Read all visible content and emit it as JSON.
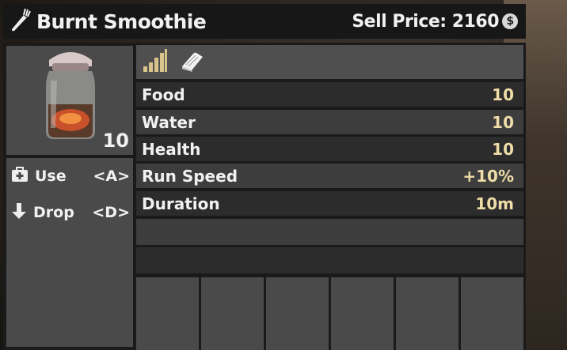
{
  "item": {
    "name": "Burnt Smoothie",
    "sell_label": "Sell Price: 2160",
    "coin_symbol": "$",
    "quantity": "10"
  },
  "actions": [
    {
      "label": "Use",
      "key": "<A>"
    },
    {
      "label": "Drop",
      "key": "<D>"
    }
  ],
  "stats": [
    {
      "name": "Food",
      "value": "10"
    },
    {
      "name": "Water",
      "value": "10"
    },
    {
      "name": "Health",
      "value": "10"
    },
    {
      "name": "Run Speed",
      "value": "+10%"
    },
    {
      "name": "Duration",
      "value": "10m"
    }
  ],
  "colors": {
    "stat_value": "#f0dca8",
    "quality_bars": "#d8c48a"
  },
  "icons": [
    "fork-icon",
    "quality-bars-icon",
    "book-icon",
    "medkit-icon",
    "arrow-down-icon",
    "coin-icon"
  ]
}
